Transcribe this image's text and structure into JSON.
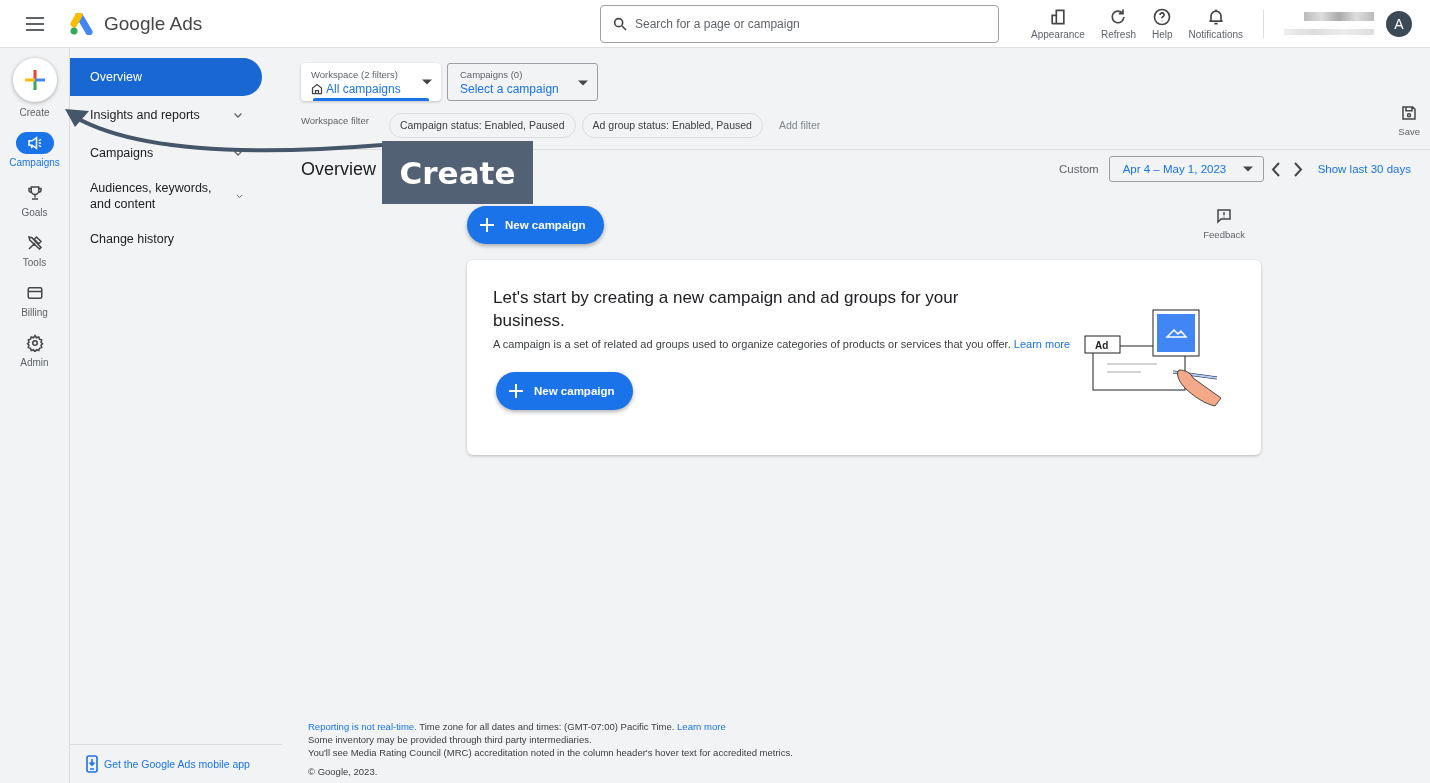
{
  "header": {
    "product_name": "Google Ads",
    "search": {
      "placeholder": "Search for a page or campaign"
    },
    "actions": [
      {
        "label": "Appearance"
      },
      {
        "label": "Refresh"
      },
      {
        "label": "Help"
      },
      {
        "label": "Notifications"
      }
    ],
    "avatar": "A"
  },
  "rail": [
    {
      "label": "Create",
      "kind": "create",
      "selected": false
    },
    {
      "label": "Campaigns",
      "kind": "item",
      "selected": true
    },
    {
      "label": "Goals",
      "kind": "item",
      "selected": false
    },
    {
      "label": "Tools",
      "kind": "item",
      "selected": false
    },
    {
      "label": "Billing",
      "kind": "item",
      "selected": false
    },
    {
      "label": "Admin",
      "kind": "item",
      "selected": false
    }
  ],
  "nav": [
    {
      "label": "Overview",
      "kind": "link",
      "selected": true
    },
    {
      "label": "Insights and reports",
      "kind": "group",
      "selected": false
    },
    {
      "label": "Campaigns",
      "kind": "group",
      "selected": false
    },
    {
      "label": "Audiences, keywords, and content",
      "kind": "group",
      "selected": false
    },
    {
      "label": "Change history",
      "kind": "link",
      "selected": false
    }
  ],
  "mobile_app_link": "Get the Google Ads mobile app",
  "filters": {
    "workspace": {
      "label": "Workspace (2 filters)",
      "value": "All campaigns"
    },
    "campaigns": {
      "label": "Campaigns (0)",
      "value": "Select a campaign"
    },
    "filter_label": "Workspace filter",
    "chips": [
      "Campaign status: Enabled, Paused",
      "Ad group status: Enabled, Paused"
    ],
    "add_filter": "Add filter",
    "save": "Save"
  },
  "page_title": "Overview",
  "date_range": {
    "label": "Custom",
    "value": "Apr 4 – May 1, 2023",
    "quick_link": "Show last 30 days"
  },
  "new_campaign_button": "New campaign",
  "feedback": "Feedback",
  "empty_state": {
    "title": "Let's start by creating a new campaign and ad groups for your business.",
    "text": "A campaign is a set of related ad groups used to organize categories of products or services that you offer.",
    "link": "Learn more",
    "button": "New campaign",
    "illustration_label": "Ad"
  },
  "footer": {
    "link": "Reporting is not real-time.",
    "text": "Time zone for all dates and times: (GMT-07:00) Pacific Time.",
    "end_link": "Learn more",
    "lines": [
      "Some inventory may be provided through third party intermediaries.",
      "You'll see Media Rating Council (MRC) accreditation noted in the column header's hover text for accredited metrics."
    ],
    "copyright": "© Google, 2023."
  },
  "callout": {
    "text": "Create"
  }
}
